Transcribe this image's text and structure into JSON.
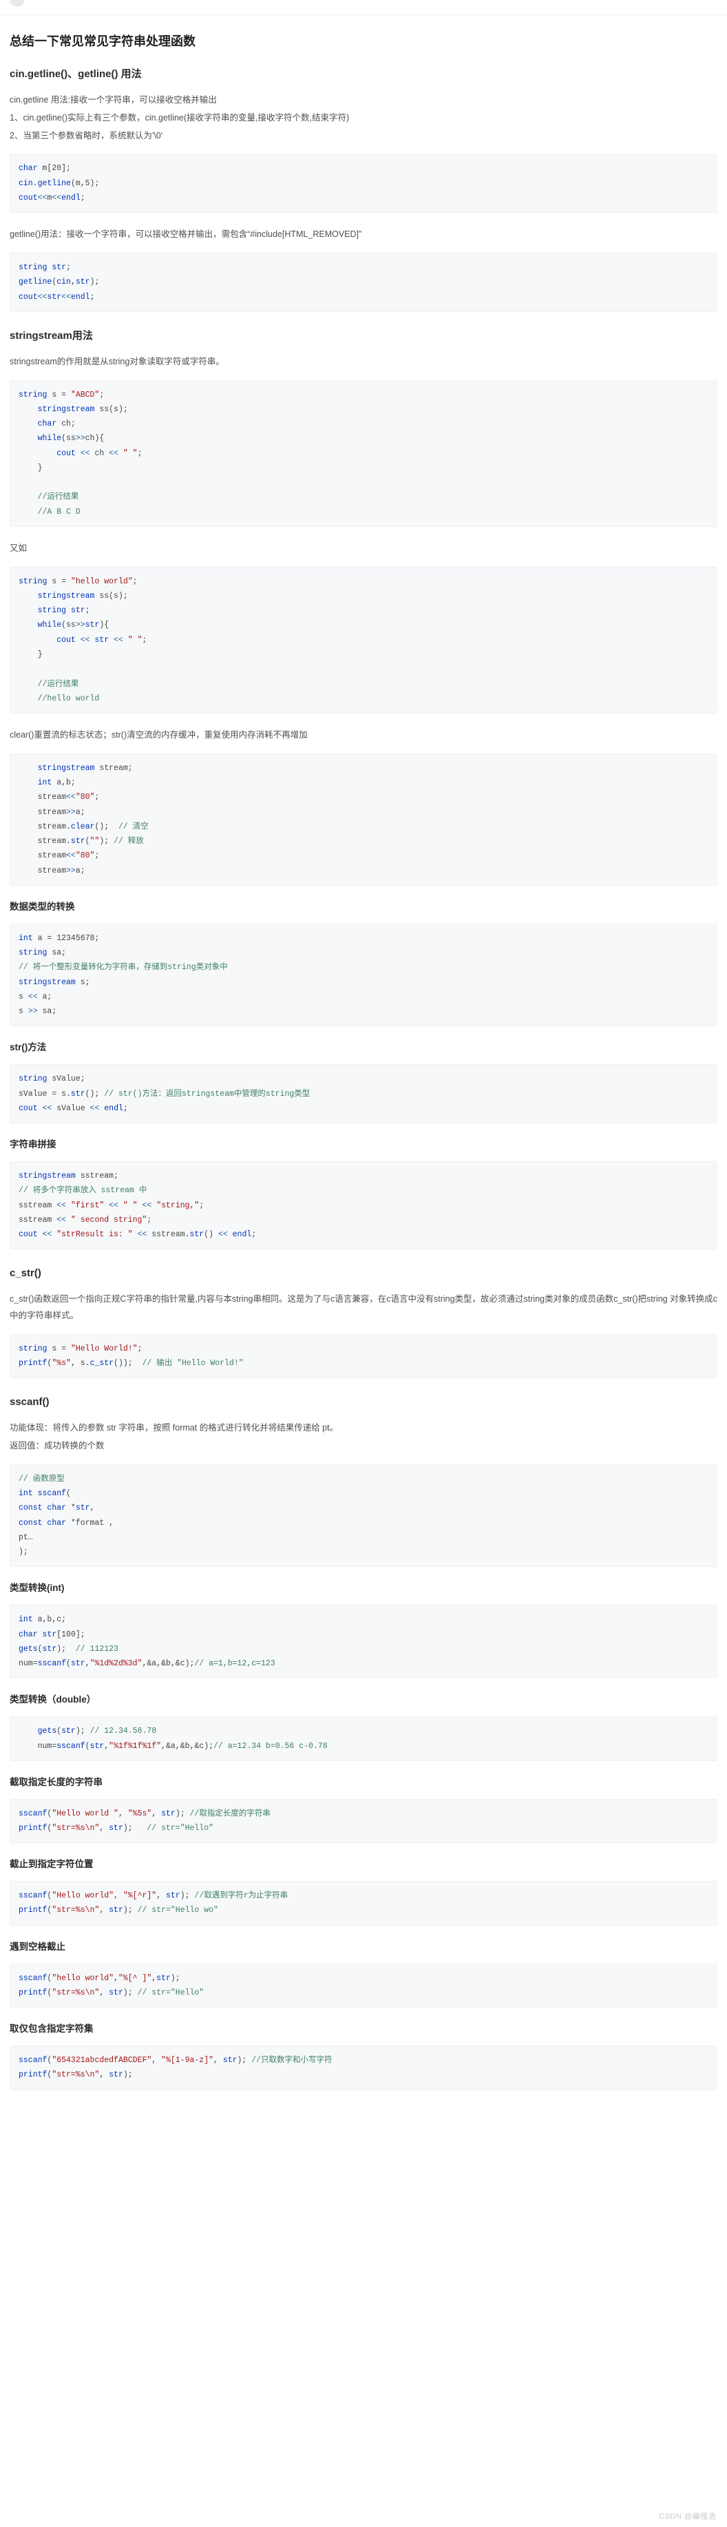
{
  "page": {
    "title": "总结一下常见常见字符串处理函数",
    "watermark": "CSDN @编程浩"
  },
  "sections": {
    "getline": {
      "heading": "cin.getline()、getline() 用法",
      "p1": "cin.getline 用法:接收一个字符串，可以接收空格并输出",
      "p2": "1、cin.getline()实际上有三个参数，cin.getline(接收字符串的变量,接收字符个数,结束字符)",
      "p3": "2、当第三个参数省略时，系统默认为'\\0'",
      "code1": "char m[20];\ncin.getline(m,5);\ncout<<m<<endl;",
      "p4": "getline()用法：接收一个字符串，可以接收空格并输出，需包含“#include[HTML_REMOVED]”",
      "code2": "string str;\ngetline(cin,str);\ncout<<str<<endl;"
    },
    "stringstream": {
      "heading": "stringstream用法",
      "p1": "stringstream的作用就是从string对象读取字符或字符串。",
      "code1": "string s = \"ABCD\";\n    stringstream ss(s);\n    char ch;\n    while(ss>>ch){\n        cout << ch << \" \";\n    }\n\n    //运行结果\n    //A B C D",
      "p2": "又如",
      "code2": "string s = \"hello world\";\n    stringstream ss(s);\n    string str;\n    while(ss>>str){\n        cout << str << \" \";\n    }\n\n    //运行结果\n    //hello world",
      "p3": "clear()重置流的标志状态；str()清空流的内存缓冲，重复使用内存消耗不再增加",
      "code3": "    stringstream stream;\n    int a,b;\n    stream<<\"80\";\n    stream>>a;\n    stream.clear();  // 清空\n    stream.str(\"\"); // 释放\n    stream<<\"80\";\n    stream>>a;"
    },
    "conversion": {
      "heading": "数据类型的转换",
      "code1": "int a = 12345678;\nstring sa;\n// 将一个整形变量转化为字符串，存储到string类对象中\nstringstream s;\ns << a;\ns >> sa;"
    },
    "strmethod": {
      "heading": "str()方法",
      "code1": "string sValue;\nsValue = s.str(); // str()方法：返回stringsteam中管理的string类型\ncout << sValue << endl;"
    },
    "concat": {
      "heading": "字符串拼接",
      "code1": "stringstream sstream;\n// 将多个字符串放入 sstream 中\nsstream << \"first\" << \" \" << \"string,\";\nsstream << \" second string\";\ncout << \"strResult is: \" << sstream.str() << endl;"
    },
    "cstr": {
      "heading": "c_str()",
      "p1": "c_str()函数返回一个指向正规C字符串的指针常量,内容与本string串相同。这是为了与c语言兼容，在c语言中没有string类型，故必须通过string类对象的成员函数c_str()把string 对象转换成c中的字符串样式。",
      "code1": "string s = \"Hello World!\";\nprintf(\"%s\", s.c_str());  // 输出 \"Hello World!\""
    },
    "sscanf": {
      "heading": "sscanf()",
      "p1": "功能体现：将传入的参数 str 字符串，按照 format 的格式进行转化并将结果传递给 pt。",
      "p2": "返回值：成功转换的个数",
      "code1": "// 函数原型\nint sscanf(\nconst char *str,\nconst char *format ,\npt…\n);"
    },
    "int_cast": {
      "heading": "类型转换(int)",
      "code1": "int a,b,c;\nchar str[100];\ngets(str);  // 112123\nnum=sscanf(str,\"%1d%2d%3d\",&a,&b,&c);// a=1,b=12,c=123"
    },
    "double_cast": {
      "heading": "类型转换（double）",
      "code1": "    gets(str); // 12.34.56.78\n    num=sscanf(str,\"%1f%1f%1f\",&a,&b,&c);// a=12.34 b=0.56 c-0.78"
    },
    "fixed_len": {
      "heading": "截取指定长度的字符串",
      "code1": "sscanf(\"Hello world \", \"%5s\", str); //取指定长度的字符串\nprintf(\"str=%s\\n\", str);   // str=\"Hello\""
    },
    "until_char": {
      "heading": "截止到指定字符位置",
      "code1": "sscanf(\"Hello world\", \"%[^r]\", str); //取遇到字符r为止字符串\nprintf(\"str=%s\\n\", str); // str=\"Hello wo\""
    },
    "until_space": {
      "heading": "遇到空格截止",
      "code1": "sscanf(\"hello world\",\"%[^ ]\",str);\nprintf(\"str=%s\\n\", str); // str=\"Hello\""
    },
    "charset": {
      "heading": "取仅包含指定字符集",
      "code1": "sscanf(\"654321abcdedfABCDEF\", \"%[1-9a-z]\", str); //只取数字和小写字符\nprintf(\"str=%s\\n\", str);"
    }
  }
}
